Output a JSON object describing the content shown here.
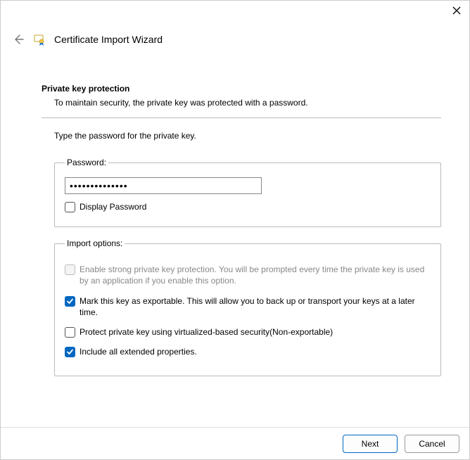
{
  "window": {
    "title": "Certificate Import Wizard"
  },
  "section": {
    "heading": "Private key protection",
    "subtext": "To maintain security, the private key was protected with a password.",
    "instruction": "Type the password for the private key."
  },
  "password_group": {
    "legend": "Password:",
    "value": "••••••••••••••",
    "display_label": "Display Password",
    "display_checked": false
  },
  "import_options": {
    "legend": "Import options:",
    "items": [
      {
        "label": "Enable strong private key protection. You will be prompted every time the private key is used by an application if you enable this option.",
        "checked": false,
        "enabled": false
      },
      {
        "label": "Mark this key as exportable. This will allow you to back up or transport your keys at a later time.",
        "checked": true,
        "enabled": true
      },
      {
        "label": "Protect private key using virtualized-based security(Non-exportable)",
        "checked": false,
        "enabled": true
      },
      {
        "label": "Include all extended properties.",
        "checked": true,
        "enabled": true
      }
    ]
  },
  "buttons": {
    "next": "Next",
    "cancel": "Cancel"
  }
}
